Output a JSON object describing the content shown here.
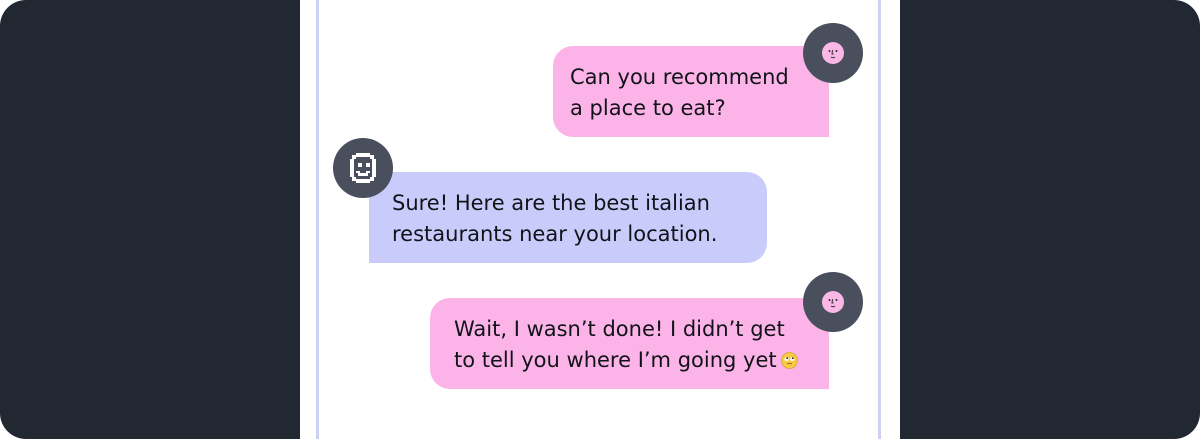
{
  "colors": {
    "background": "#212832",
    "user_bubble": "#fcb4e8",
    "bot_bubble": "#c9ccfb",
    "avatar": "#4a4f5e"
  },
  "messages": [
    {
      "sender": "user",
      "lines": [
        "Can you recommend",
        "a place to eat?"
      ],
      "avatar_icon": "user-face-icon"
    },
    {
      "sender": "assistant",
      "lines": [
        "Sure! Here are the best italian",
        "restaurants near your location."
      ],
      "avatar_icon": "robot-smiley-icon"
    },
    {
      "sender": "user",
      "lines": [
        "Wait, I wasn’t done! I didn’t get",
        "to tell you where I’m going yet"
      ],
      "emoji": "eye-roll-emoji-icon",
      "avatar_icon": "user-face-icon"
    }
  ]
}
